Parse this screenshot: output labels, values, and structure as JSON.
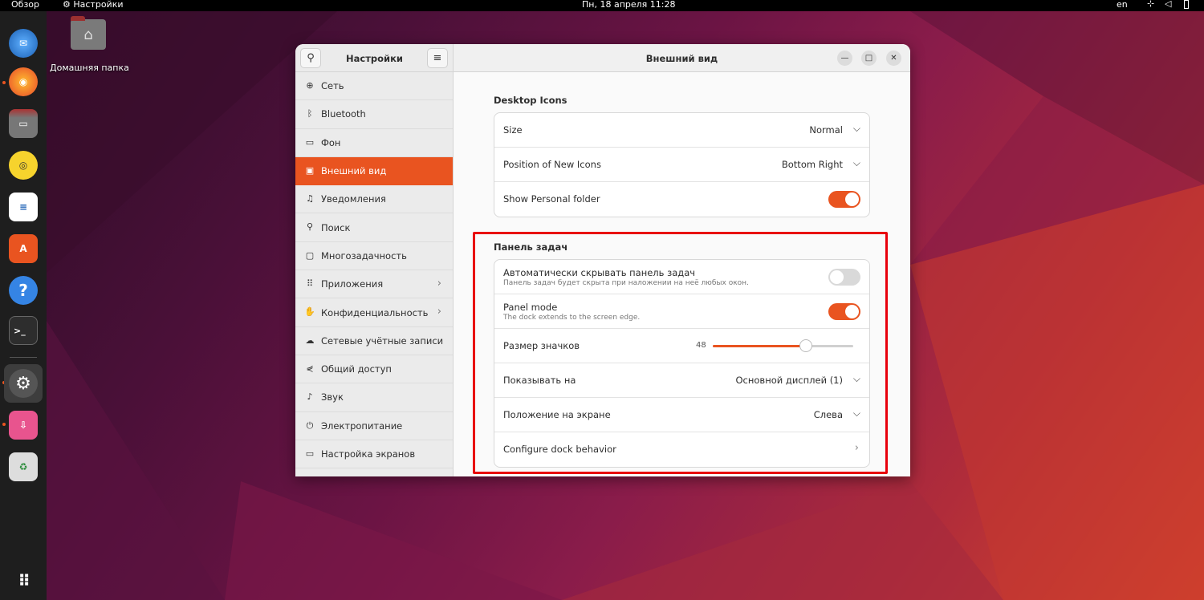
{
  "topbar": {
    "overview": "Обзор",
    "app_menu": "Настройки",
    "clock": "Пн, 18 апреля  11:28",
    "lang": "en",
    "network_icon": "network-icon",
    "volume_icon": "volume-icon",
    "battery_icon": "battery-icon"
  },
  "desktop": {
    "home_folder_label": "Домашняя папка"
  },
  "dock": {
    "items": [
      {
        "name": "thunderbird"
      },
      {
        "name": "firefox"
      },
      {
        "name": "files"
      },
      {
        "name": "rhythmbox"
      },
      {
        "name": "writer"
      },
      {
        "name": "app-center"
      },
      {
        "name": "help"
      },
      {
        "name": "terminal"
      },
      {
        "name": "settings"
      },
      {
        "name": "installer"
      },
      {
        "name": "trash"
      }
    ],
    "accent": "#e95420"
  },
  "sidebar": {
    "title": "Настройки",
    "items": [
      {
        "label": "Сеть",
        "icon": "globe-icon"
      },
      {
        "label": "Bluetooth",
        "icon": "bluetooth-icon"
      },
      {
        "label": "Фон",
        "icon": "monitor-icon"
      },
      {
        "label": "Внешний вид",
        "icon": "appearance-icon"
      },
      {
        "label": "Уведомления",
        "icon": "bell-icon"
      },
      {
        "label": "Поиск",
        "icon": "search-icon"
      },
      {
        "label": "Многозадачность",
        "icon": "multitasking-icon"
      },
      {
        "label": "Приложения",
        "icon": "grid-icon"
      },
      {
        "label": "Конфиденциальность",
        "icon": "hand-icon"
      },
      {
        "label": "Сетевые учётные записи",
        "icon": "cloud-icon"
      },
      {
        "label": "Общий доступ",
        "icon": "share-icon"
      },
      {
        "label": "Звук",
        "icon": "music-icon"
      },
      {
        "label": "Электропитание",
        "icon": "power-icon"
      },
      {
        "label": "Настройка экранов",
        "icon": "display-icon"
      }
    ]
  },
  "main": {
    "title": "Внешний вид",
    "desktop_icons": {
      "title": "Desktop Icons",
      "size_label": "Size",
      "size_value": "Normal",
      "position_label": "Position of New Icons",
      "position_value": "Bottom Right",
      "personal_label": "Show Personal folder",
      "personal_on": true
    },
    "taskbar": {
      "title": "Панель задач",
      "autohide_label": "Автоматически скрывать панель задач",
      "autohide_sub": "Панель задач будет скрыта при наложении на неё любых окон.",
      "autohide_on": false,
      "panel_mode_label": "Panel mode",
      "panel_mode_sub": "The dock extends to the screen edge.",
      "panel_mode_on": true,
      "icon_size_label": "Размер значков",
      "icon_size_value": "48",
      "icon_size_fraction": 0.66,
      "show_on_label": "Показывать на",
      "show_on_value": "Основной дисплей (1)",
      "position_label": "Положение на экране",
      "position_value": "Слева",
      "configure_label": "Configure dock behavior"
    }
  }
}
